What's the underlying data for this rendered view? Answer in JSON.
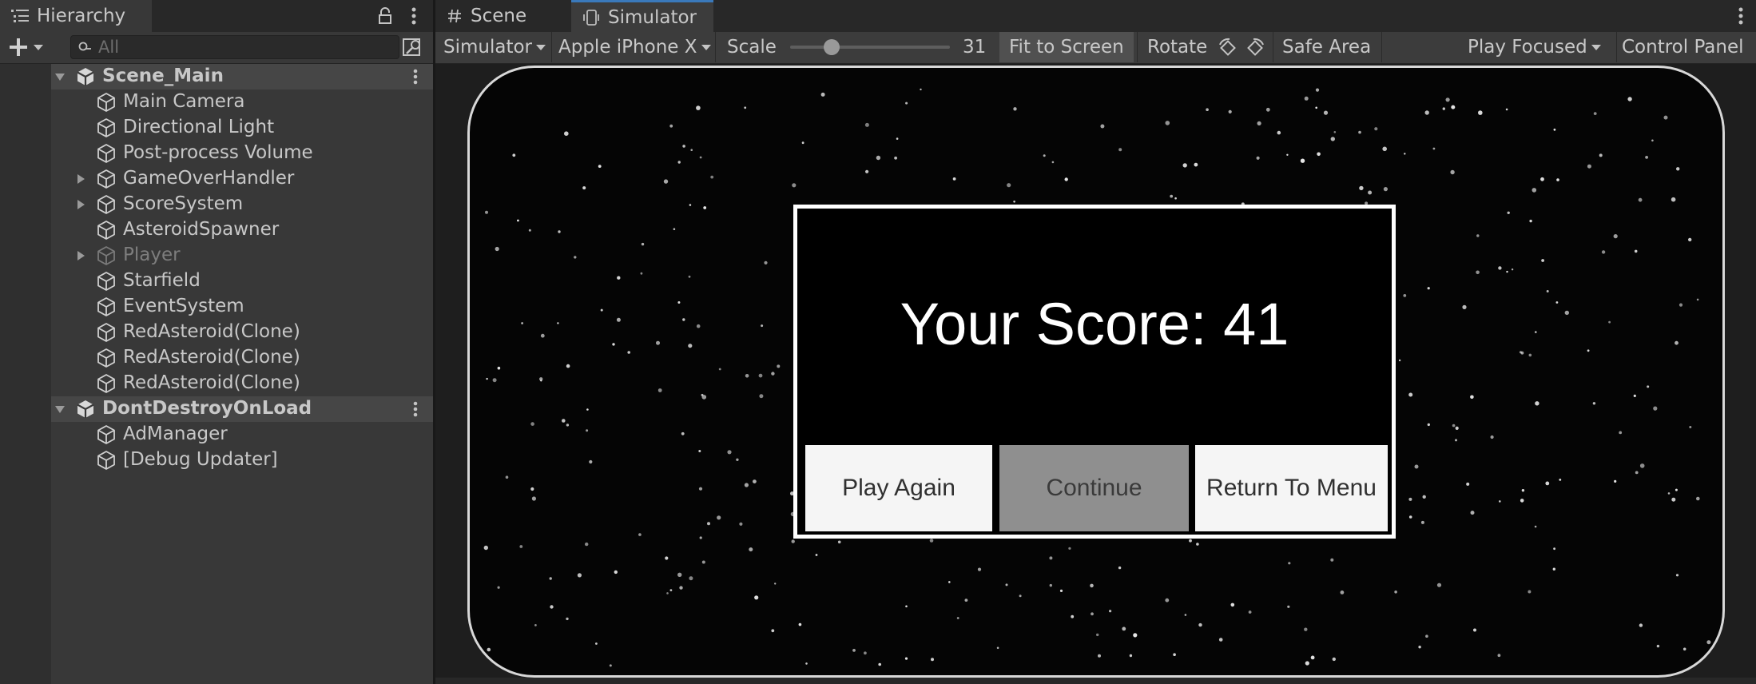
{
  "hierarchy": {
    "tab_label": "Hierarchy",
    "search_placeholder": "All",
    "items": [
      {
        "label": "Scene_Main"
      },
      {
        "label": "Main Camera"
      },
      {
        "label": "Directional Light"
      },
      {
        "label": "Post-process Volume"
      },
      {
        "label": "GameOverHandler"
      },
      {
        "label": "ScoreSystem"
      },
      {
        "label": "AsteroidSpawner"
      },
      {
        "label": "Player"
      },
      {
        "label": "Starfield"
      },
      {
        "label": "EventSystem"
      },
      {
        "label": "RedAsteroid(Clone)"
      },
      {
        "label": "RedAsteroid(Clone)"
      },
      {
        "label": "RedAsteroid(Clone)"
      },
      {
        "label": "DontDestroyOnLoad"
      },
      {
        "label": "AdManager"
      },
      {
        "label": "[Debug Updater]"
      }
    ]
  },
  "tabs": {
    "scene": "Scene",
    "simulator": "Simulator"
  },
  "toolbar": {
    "mode": "Simulator",
    "device": "Apple iPhone X",
    "scale_label": "Scale",
    "scale_value": "31",
    "fit_to_screen": "Fit to Screen",
    "rotate": "Rotate",
    "safe_area": "Safe Area",
    "play_mode": "Play Focused",
    "control_panel": "Control Panel"
  },
  "game": {
    "score_text": "Your Score: 41",
    "buttons": {
      "play_again": "Play Again",
      "continue": "Continue",
      "return_to_menu": "Return To Menu"
    }
  },
  "colors": {
    "panel_bg": "#383838",
    "tab_accent": "#3a79bb",
    "device_frame": "#d8d8d8",
    "disabled_button": "#8f8f8f"
  }
}
